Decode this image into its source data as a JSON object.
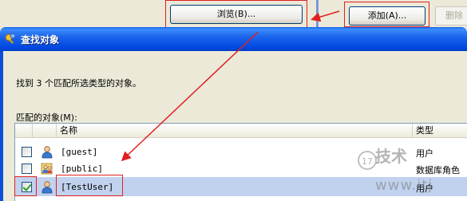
{
  "parent": {
    "browse_label": "浏览(B)...",
    "add_label": "添加(A)...",
    "delete_label": "删除"
  },
  "dialog": {
    "title": "查找对象",
    "found_text": "找到 3 个匹配所选类型的对象。",
    "matches_label": "匹配的对象(M):",
    "columns": {
      "name": "名称",
      "type": "类型"
    },
    "rows": [
      {
        "name": "[guest]",
        "type": "用户",
        "checked": false,
        "selected": false,
        "icon": "user-icon"
      },
      {
        "name": "[public]",
        "type": "数据库角色",
        "checked": false,
        "selected": false,
        "icon": "role-icon"
      },
      {
        "name": "[TestUser]",
        "type": "用户",
        "checked": true,
        "selected": true,
        "icon": "user-icon"
      }
    ]
  },
  "watermark": {
    "logo_text": "17",
    "brand": "技术",
    "url": "www.itj"
  },
  "colors": {
    "annotation": "#e02020",
    "titlebar": "#0a55e0",
    "selection": "#c1d2ee"
  }
}
